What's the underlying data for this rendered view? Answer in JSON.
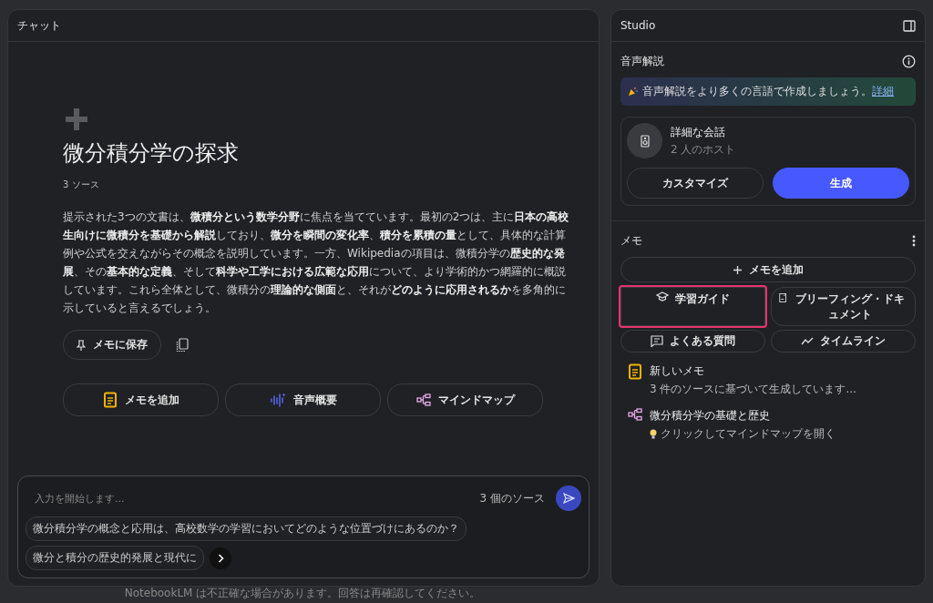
{
  "chat": {
    "title": "チャット",
    "notebook_title": "微分積分学の探求",
    "source_count": "3 ソース",
    "summary": "提示された3つの文書は、**微積分という数学分野**に焦点を当てています。最初の2つは、主に**日本の高校生向けに微積分を基礎から解説**しており、**微分を瞬間の変化率**、**積分を累積の量**として、具体的な計算例や公式を交えながらその概念を説明しています。一方、Wikipediaの項目は、微積分学の**歴史的な発展**、その**基本的な定義**、そして**科学や工学における広範な応用**について、より学術的かつ網羅的に概説しています。これら全体として、微積分の**理論的な側面**と、それが**どのように応用されるか**を多角的に示していると言えるでしょう。",
    "save_button": "メモに保存",
    "actions": [
      {
        "kind": "note",
        "label": "メモを追加"
      },
      {
        "kind": "audio",
        "label": "音声概要"
      },
      {
        "kind": "mindmap",
        "label": "マインドマップ"
      }
    ],
    "input": {
      "placeholder": "入力を開始します...",
      "source_count": "3 個のソース"
    },
    "suggestions": [
      "微分積分学の概念と応用は、高校数学の学習においてどのような位置づけにあるのか？",
      "微分と積分の歴史的発展と現代に"
    ],
    "footer": "NotebookLM は不正確な場合があります。回答は再確認してください。"
  },
  "studio": {
    "title": "Studio",
    "audio": {
      "title": "音声解説",
      "banner": "音声解説をより多くの言語で作成しましょう。",
      "banner_link": "詳細",
      "format_title": "詳細な会話",
      "format_subtitle": "2 人のホスト",
      "customize": "カスタマイズ",
      "generate": "生成"
    },
    "notes": {
      "title": "メモ",
      "add": "メモを追加",
      "tools": [
        {
          "kind": "study",
          "label": "学習ガイド",
          "highlighted": true
        },
        {
          "kind": "briefing",
          "label": "ブリーフィング・ドキュメント",
          "highlighted": false
        },
        {
          "kind": "faq",
          "label": "よくある質問",
          "highlighted": false
        },
        {
          "kind": "timeline",
          "label": "タイムライン",
          "highlighted": false
        }
      ],
      "items": [
        {
          "kind": "note",
          "title": "新しいメモ",
          "subtitle": "3 件のソースに基づいて生成しています..."
        },
        {
          "kind": "mindmap",
          "title": "微分積分学の基礎と歴史",
          "subtitle": "クリックしてマインドマップを開く"
        }
      ]
    }
  }
}
